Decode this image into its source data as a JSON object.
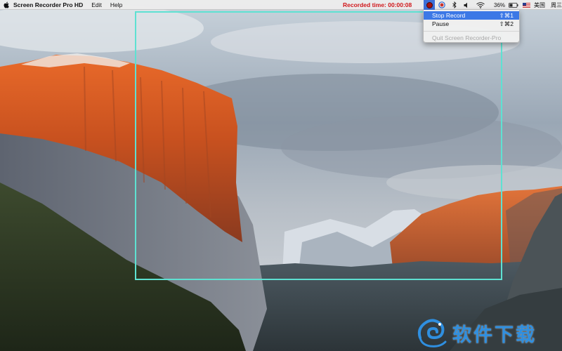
{
  "menubar": {
    "apple_icon": "apple-logo-icon",
    "app_name": "Screen Recorder Pro HD",
    "menus": [
      "Edit",
      "Help"
    ],
    "recorded_time": "Recorded time: 00:00:08",
    "status": {
      "battery_percent": "36%",
      "input_language": "美国",
      "weekday": "周三下"
    }
  },
  "dropdown": {
    "items": [
      {
        "label": "Stop Record",
        "shortcut": "⇧⌘1",
        "highlighted": true,
        "enabled": true
      },
      {
        "label": "Pause",
        "shortcut": "⇧⌘2",
        "highlighted": false,
        "enabled": true
      },
      {
        "label": "Quit Screen Recorder-Pro",
        "shortcut": "",
        "highlighted": false,
        "enabled": false
      }
    ]
  },
  "capture_frame": {
    "color": "#5ee1d2"
  },
  "watermark": {
    "text": "软件下载",
    "color": "#2f8fe0"
  },
  "colors": {
    "recorded_time": "#d0181b",
    "menu_highlight": "#3c78e6"
  }
}
